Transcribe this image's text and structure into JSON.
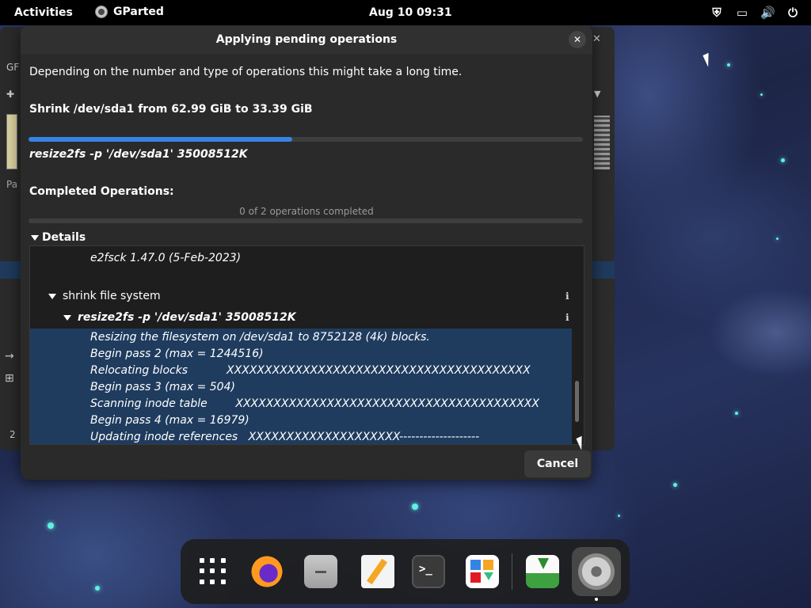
{
  "topbar": {
    "activities": "Activities",
    "app_name": "GParted",
    "clock": "Aug 10  09:31"
  },
  "dialog": {
    "title": "Applying pending operations",
    "description": "Depending on the number and type of operations this might take a long time.",
    "operation_title": "Shrink /dev/sda1 from 62.99 GiB to 33.39 GiB",
    "operation_progress": 0.475,
    "current_command": "resize2fs -p '/dev/sda1' 35008512K",
    "completed_label": "Completed Operations:",
    "completed_count": "0 of 2 operations completed",
    "details_label": "Details",
    "tree": {
      "e2fsck": "e2fsck 1.47.0 (5-Feb-2023)",
      "shrink": "shrink file system",
      "resize_cmd": "resize2fs -p '/dev/sda1' 35008512K",
      "output": [
        "Resizing the filesystem on /dev/sda1 to 8752128 (4k) blocks.",
        "Begin pass 2 (max = 1244516)",
        "Relocating blocks           XXXXXXXXXXXXXXXXXXXXXXXXXXXXXXXXXXXXXXXX",
        "Begin pass 3 (max = 504)",
        "Scanning inode table        XXXXXXXXXXXXXXXXXXXXXXXXXXXXXXXXXXXXXXXX",
        "Begin pass 4 (max = 16979)",
        "Updating inode references   XXXXXXXXXXXXXXXXXXXX--------------------"
      ]
    },
    "cancel_label": "Cancel"
  },
  "background_window": {
    "title_fragment": "GF",
    "column_fragment": "Pa",
    "count_fragment": "2"
  },
  "colors": {
    "accent": "#3584e4",
    "selection": "#1f3c5e",
    "dialog_bg": "#2a2a2a"
  }
}
